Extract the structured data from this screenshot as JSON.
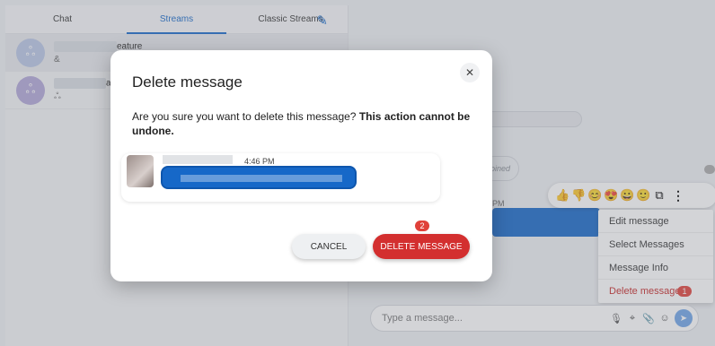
{
  "tabs": [
    "Chat",
    "Streams",
    "Classic Streams"
  ],
  "conversations": [
    {
      "name_suffix": "eature",
      "sub": "&"
    },
    {
      "name_suffix": "al",
      "sub": "ஃ"
    }
  ],
  "right": {
    "joined_label": "oined",
    "time_label": "PM",
    "reactions": [
      "👍",
      "👎",
      "😊",
      "😍",
      "😀",
      "🙂"
    ],
    "context_menu": [
      "Edit message",
      "Select Messages",
      "Message Info",
      "Delete message"
    ],
    "badge_delete": "1",
    "composer_placeholder": "Type a message..."
  },
  "modal": {
    "title": "Delete message",
    "body_plain": "Are you sure you want to delete this message? ",
    "body_bold": "This action cannot be undone.",
    "preview_time": "4:46 PM",
    "cancel_label": "CANCEL",
    "delete_label": "DELETE MESSAGE",
    "badge_delete": "2",
    "close_glyph": "✕"
  }
}
